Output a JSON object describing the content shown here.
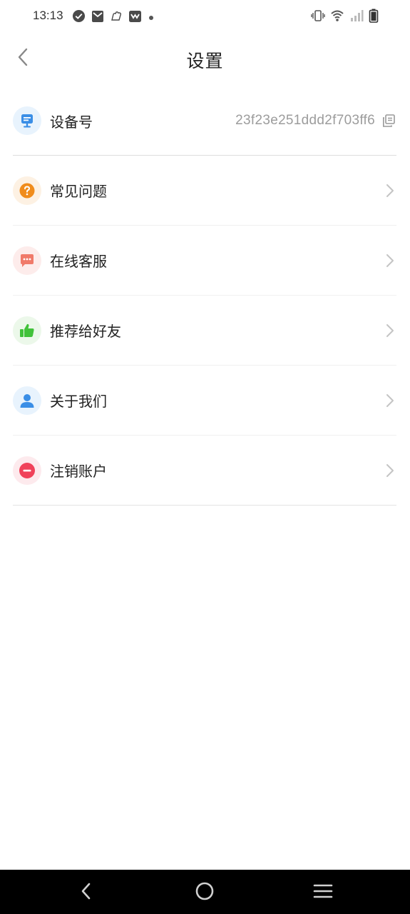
{
  "status_bar": {
    "time": "13:13",
    "left_icons": [
      "check-circle-icon",
      "mail-icon",
      "hand-icon",
      "envelope-icon",
      "dot-icon"
    ],
    "right_icons": [
      "vibrate-icon",
      "wifi-icon",
      "signal-icon",
      "battery-icon"
    ]
  },
  "header": {
    "title": "设置",
    "back_icon": "chevron-left-icon"
  },
  "settings": {
    "device": {
      "label": "设备号",
      "value": "23f23e251ddd2f703ff6",
      "icon": "device-icon",
      "icon_color": "#3a8ee6",
      "icon_bg": "#e8f3fd"
    },
    "items": [
      {
        "label": "常见问题",
        "icon": "question-icon",
        "icon_color": "#f08c1c",
        "icon_bg": "#fdf1e3"
      },
      {
        "label": "在线客服",
        "icon": "chat-icon",
        "icon_color": "#f07a6a",
        "icon_bg": "#fdeceb"
      },
      {
        "label": "推荐给好友",
        "icon": "thumbs-up-icon",
        "icon_color": "#41c23a",
        "icon_bg": "#ecf8ea"
      },
      {
        "label": "关于我们",
        "icon": "user-icon",
        "icon_color": "#3a8ee6",
        "icon_bg": "#e8f3fd"
      },
      {
        "label": "注销账户",
        "icon": "minus-circle-icon",
        "icon_color": "#f0425a",
        "icon_bg": "#fdeaed"
      }
    ]
  },
  "nav_bar": {
    "buttons": [
      "back-icon",
      "home-icon",
      "menu-icon"
    ]
  }
}
